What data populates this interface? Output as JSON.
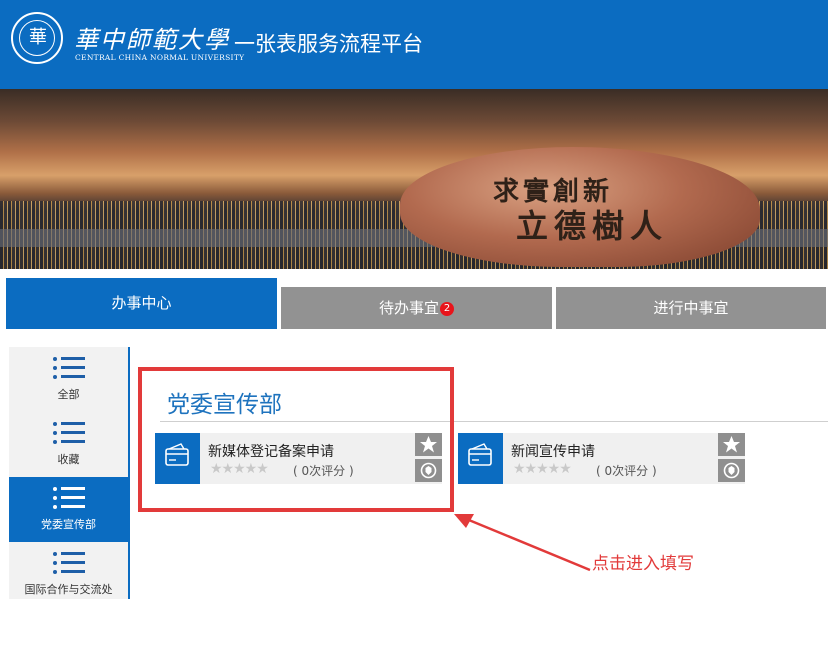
{
  "header": {
    "logo_seal_char": "華",
    "logo_cn": "華中師範大學",
    "logo_en": "CENTRAL CHINA NORMAL UNIVERSITY",
    "app_title": "一张表服务流程平台"
  },
  "banner": {
    "motto_line1": "求實創新",
    "motto_line2": "立德樹人"
  },
  "tabs": [
    {
      "label": "办事中心",
      "active": true
    },
    {
      "label": "待办事宜",
      "badge": "2"
    },
    {
      "label": "进行中事宜"
    }
  ],
  "sidebar": {
    "items": [
      {
        "label": "全部",
        "icon": "list-icon"
      },
      {
        "label": "收藏",
        "icon": "list-icon"
      },
      {
        "label": "党委宣传部",
        "icon": "list-icon",
        "active": true
      },
      {
        "label": "国际合作与交流处",
        "icon": "list-icon"
      }
    ]
  },
  "main": {
    "section_title": "党委宣传部",
    "cards": [
      {
        "name": "新媒体登记备案申请",
        "rating_text": "( 0次评分 )",
        "stars": 0
      },
      {
        "name": "新闻宣传申请",
        "rating_text": "( 0次评分 )",
        "stars": 0
      }
    ]
  },
  "annotation": {
    "text": "点击进入填写",
    "color": "#e23a3a"
  },
  "colors": {
    "brand_blue": "#0b6cc1",
    "tab_gray": "#929292",
    "badge_red": "#e8141b"
  }
}
